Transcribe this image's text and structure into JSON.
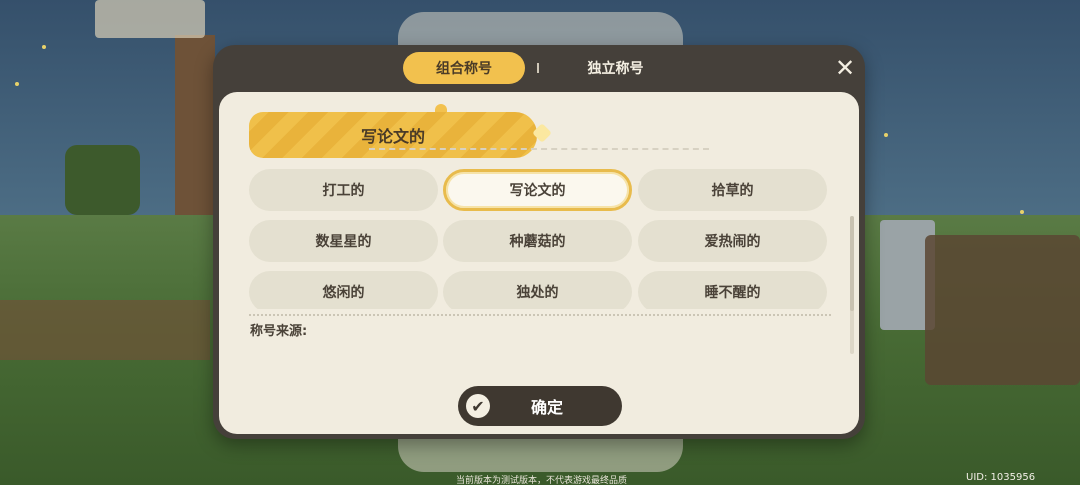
{
  "tabs": {
    "combo_label": "组合称号",
    "single_label": "独立称号",
    "active": "组合称号"
  },
  "close_icon": "close-icon",
  "title_display": "写论文的",
  "options": [
    {
      "label": "打工的",
      "selected": false
    },
    {
      "label": "写论文的",
      "selected": true
    },
    {
      "label": "拾草的",
      "selected": false
    },
    {
      "label": "数星星的",
      "selected": false
    },
    {
      "label": "种蘑菇的",
      "selected": false
    },
    {
      "label": "爱热闹的",
      "selected": false
    },
    {
      "label": "悠闲的",
      "selected": false
    },
    {
      "label": "独处的",
      "selected": false
    },
    {
      "label": "睡不醒的",
      "selected": false
    }
  ],
  "source_label": "称号来源:",
  "confirm_label": "确定",
  "confirm_icon": "check-icon",
  "footer_note": "当前版本为测试版本，不代表游戏最终品质",
  "uid": "UID: 1035956",
  "colors": {
    "accent": "#f2c14e",
    "panel": "#f1ecdf",
    "dialog_frame": "#45403a",
    "chip": "#e4e0d0",
    "button_dark": "#3f3830"
  }
}
